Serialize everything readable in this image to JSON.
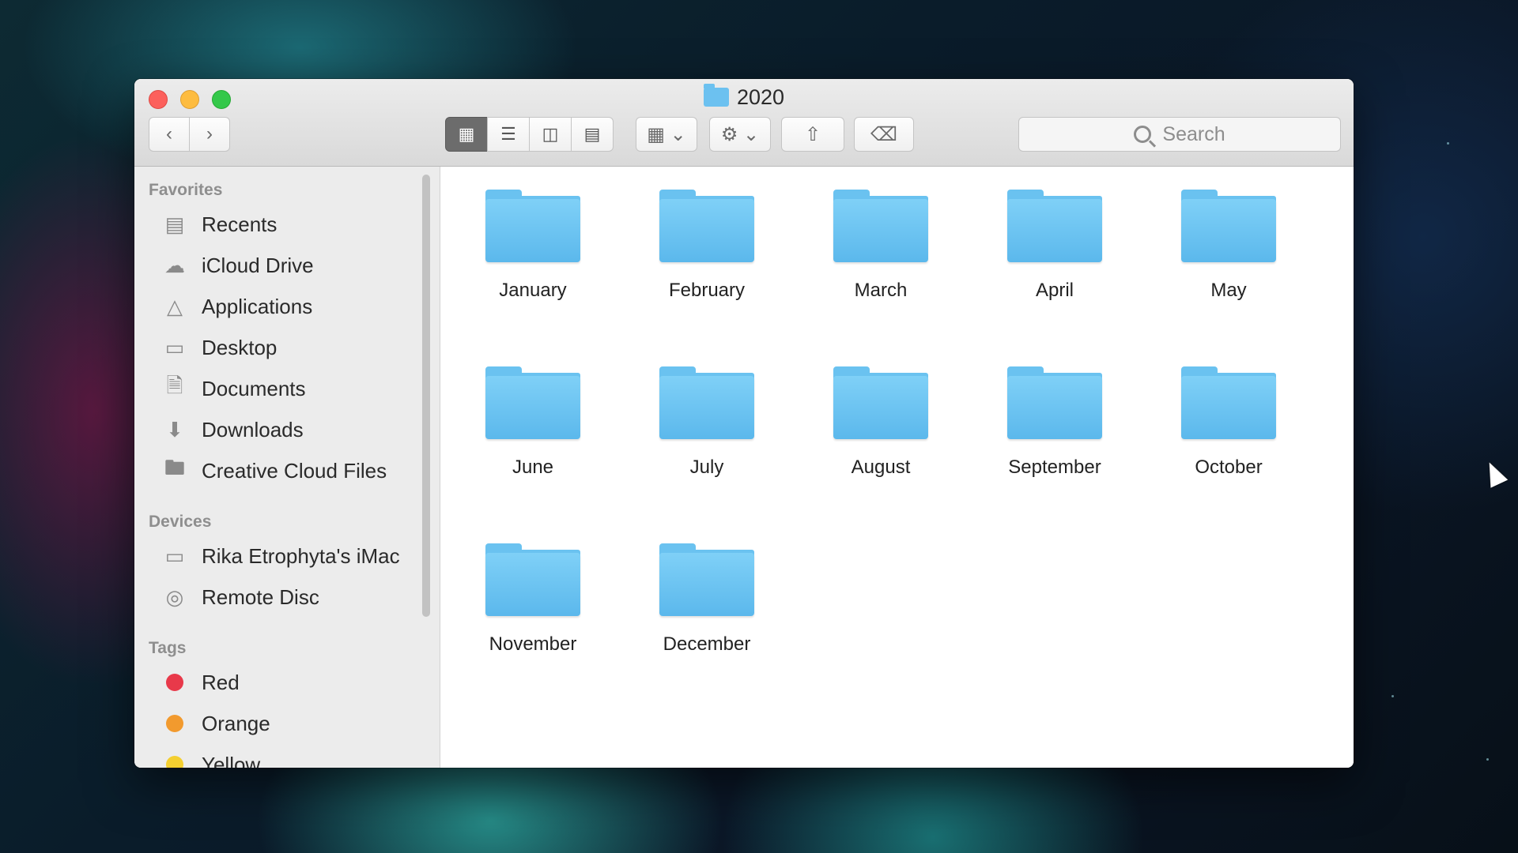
{
  "window": {
    "title": "2020"
  },
  "toolbar": {
    "back_icon": "chevron-left-icon",
    "forward_icon": "chevron-right-icon",
    "view_modes": [
      "icon-view",
      "list-view",
      "column-view",
      "gallery-view"
    ],
    "search_placeholder": "Search"
  },
  "sidebar": {
    "favorites_header": "Favorites",
    "favorites": [
      {
        "label": "Recents",
        "icon": "recents-icon"
      },
      {
        "label": "iCloud Drive",
        "icon": "cloud-icon"
      },
      {
        "label": "Applications",
        "icon": "applications-icon"
      },
      {
        "label": "Desktop",
        "icon": "desktop-icon"
      },
      {
        "label": "Documents",
        "icon": "documents-icon"
      },
      {
        "label": "Downloads",
        "icon": "downloads-icon"
      },
      {
        "label": "Creative Cloud Files",
        "icon": "folder-icon"
      }
    ],
    "devices_header": "Devices",
    "devices": [
      {
        "label": "Rika Etrophyta's iMac",
        "icon": "imac-icon"
      },
      {
        "label": "Remote Disc",
        "icon": "disc-icon"
      }
    ],
    "tags_header": "Tags",
    "tags": [
      {
        "label": "Red",
        "color": "#e8394a"
      },
      {
        "label": "Orange",
        "color": "#f29a2e"
      },
      {
        "label": "Yellow",
        "color": "#f4cf30"
      }
    ]
  },
  "folders": [
    "January",
    "February",
    "March",
    "April",
    "May",
    "June",
    "July",
    "August",
    "September",
    "October",
    "November",
    "December"
  ]
}
